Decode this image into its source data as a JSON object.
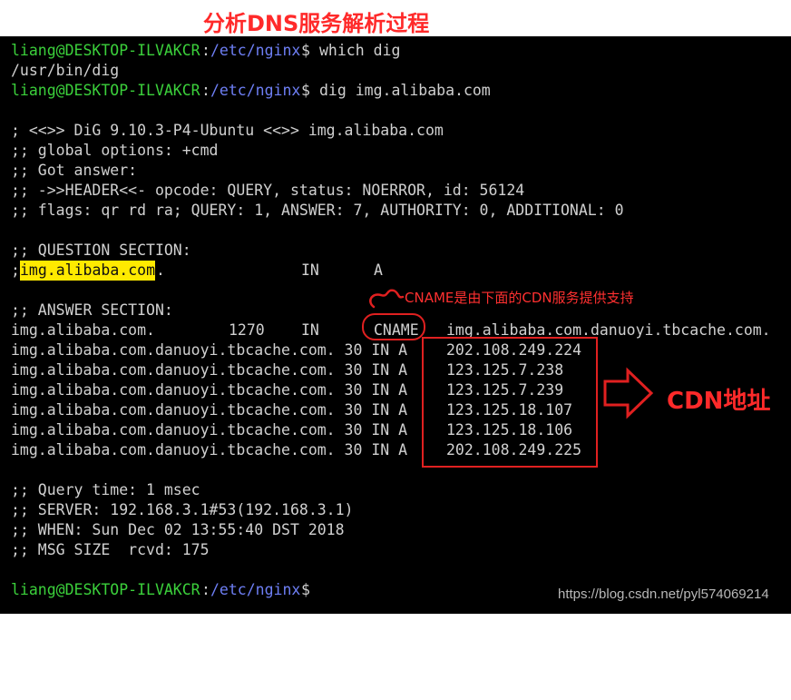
{
  "title": "分析DNS服务解析过程",
  "terminal": {
    "prompt": {
      "user": "liang@DESKTOP-ILVAKCR",
      "sep": ":",
      "path": "/etc/nginx",
      "sign": "$"
    },
    "cmd1": "which dig",
    "out1": "/usr/bin/dig",
    "cmd2": "dig img.alibaba.com",
    "header": [
      "; <<>> DiG 9.10.3-P4-Ubuntu <<>> img.alibaba.com",
      ";; global options: +cmd",
      ";; Got answer:",
      ";; ->>HEADER<<- opcode: QUERY, status: NOERROR, id: 56124",
      ";; flags: qr rd ra; QUERY: 1, ANSWER: 7, AUTHORITY: 0, ADDITIONAL: 0"
    ],
    "question_title": ";; QUESTION SECTION:",
    "question": {
      "prefix": ";",
      "name": "img.alibaba.com",
      "dot": ".",
      "class": "IN",
      "type": "A"
    },
    "answer_title": ";; ANSWER SECTION:",
    "answer_cname": {
      "name": "img.alibaba.com.",
      "ttl": "1270",
      "class": "IN",
      "type": "CNAME",
      "target": "img.alibaba.com.danuoyi.tbcache.com."
    },
    "answer_records": [
      {
        "left": "img.alibaba.com.danuoyi.tbcache.com. 30 IN A",
        "ip": "202.108.249.224"
      },
      {
        "left": "img.alibaba.com.danuoyi.tbcache.com. 30 IN A",
        "ip": "123.125.7.238"
      },
      {
        "left": "img.alibaba.com.danuoyi.tbcache.com. 30 IN A",
        "ip": "123.125.7.239"
      },
      {
        "left": "img.alibaba.com.danuoyi.tbcache.com. 30 IN A",
        "ip": "123.125.18.107"
      },
      {
        "left": "img.alibaba.com.danuoyi.tbcache.com. 30 IN A",
        "ip": "123.125.18.106"
      },
      {
        "left": "img.alibaba.com.danuoyi.tbcache.com. 30 IN A",
        "ip": "202.108.249.225"
      }
    ],
    "footer": [
      ";; Query time: 1 msec",
      ";; SERVER: 192.168.3.1#53(192.168.3.1)",
      ";; WHEN: Sun Dec 02 13:55:40 DST 2018",
      ";; MSG SIZE  rcvd: 175"
    ]
  },
  "annotations": {
    "cname_note": "CNAME是由下面的CDN服务提供支持",
    "cdn_label": "CDN地址",
    "color": "#e02020"
  },
  "watermark": "https://blog.csdn.net/pyl574069214",
  "colors": {
    "background": "#000000",
    "text": "#d0d0d0",
    "user": "#3bd03b",
    "path": "#6e7ff5",
    "highlight": "#ffea00",
    "annotation": "#ff2a2a"
  }
}
